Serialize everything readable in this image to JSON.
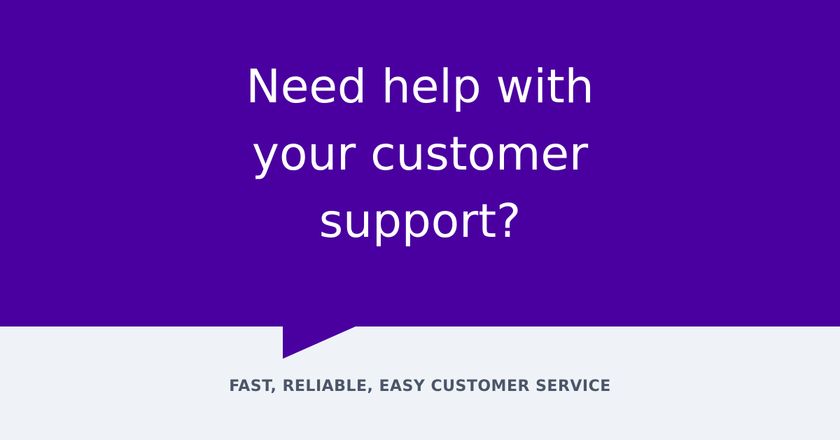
{
  "headline": {
    "lines": [
      "Need help with",
      "your customer",
      "support?"
    ]
  },
  "tagline": "FAST, RELIABLE, EASY CUSTOMER SERVICE",
  "colors": {
    "brand_purple": "#4a00a0",
    "background_light": "#eff3f8",
    "headline_text": "#ffffff",
    "tagline_text": "#4b5668"
  },
  "decoration": {
    "speech_bubble_tail_icon": "speech-bubble-tail-icon"
  }
}
